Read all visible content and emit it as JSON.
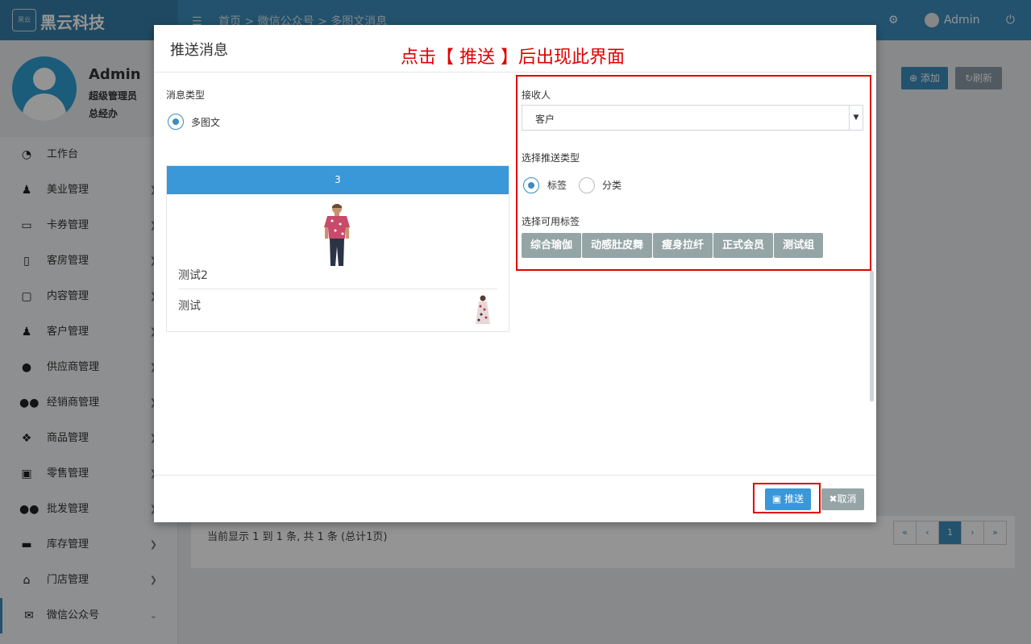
{
  "app": {
    "brand_logo_text": "黑云科技",
    "brand_name": "黑云科技",
    "breadcrumb": "首页 > 微信公众号 > 多图文消息",
    "user": "Admin"
  },
  "sidebar": {
    "user_name": "Admin",
    "user_role": "超级管理员",
    "user_dept": "总经办",
    "items": [
      {
        "label": "工作台",
        "icon": "dashboard-icon"
      },
      {
        "label": "美业管理",
        "icon": "person-icon"
      },
      {
        "label": "卡券管理",
        "icon": "card-icon"
      },
      {
        "label": "客房管理",
        "icon": "building-icon"
      },
      {
        "label": "内容管理",
        "icon": "file-icon"
      },
      {
        "label": "客户管理",
        "icon": "person-icon"
      },
      {
        "label": "供应商管理",
        "icon": "user-icon"
      },
      {
        "label": "经销商管理",
        "icon": "users-icon"
      },
      {
        "label": "商品管理",
        "icon": "cubes-icon"
      },
      {
        "label": "零售管理",
        "icon": "money-icon"
      },
      {
        "label": "批发管理",
        "icon": "users-icon"
      },
      {
        "label": "库存管理",
        "icon": "archive-icon"
      },
      {
        "label": "门店管理",
        "icon": "home-icon"
      },
      {
        "label": "微信公众号",
        "icon": "wechat-icon"
      }
    ]
  },
  "background": {
    "add_label": "添加",
    "refresh_label": "刷新",
    "page_info": "当前显示 1 到 1 条, 共 1 条 (总计1页)",
    "pager": [
      "«",
      "‹",
      "1",
      "›",
      "»"
    ]
  },
  "modal": {
    "title": "推送消息",
    "annotation": "点击【 推送 】后出现此界面",
    "message_type_label": "消息类型",
    "message_type_option": "多图文",
    "news_header": "3",
    "news_items": [
      "测试2",
      "测试"
    ],
    "receiver_label": "接收人",
    "receiver_value": "客户",
    "push_type_label": "选择推送类型",
    "push_type_options": [
      "标签",
      "分类"
    ],
    "tags_label": "选择可用标签",
    "tags": [
      "综合瑜伽",
      "动感肚皮舞",
      "瘦身拉纤",
      "正式会员",
      "测试组"
    ],
    "push_button": "推送",
    "cancel_button": "取消"
  },
  "colors": {
    "primary": "#3c8dbc",
    "annotation_red": "#e00000",
    "tag_gray": "#95a5a6"
  }
}
